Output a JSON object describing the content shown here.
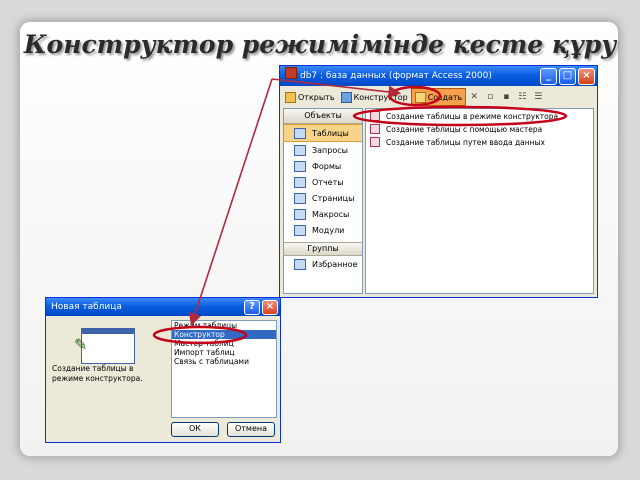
{
  "slide": {
    "title": "Конструктор режиміміндe кесте құру"
  },
  "db_window": {
    "title": "db7 : база данных (формат Access 2000)",
    "controls": {
      "minimize": "_",
      "maximize": "□",
      "close": "×"
    },
    "toolbar": {
      "open": "Открыть",
      "design": "Конструктор",
      "create": "Создать"
    },
    "panel_header": "Объекты",
    "objects": [
      {
        "label": "Таблицы",
        "icon": "table-icon"
      },
      {
        "label": "Запросы",
        "icon": "query-icon"
      },
      {
        "label": "Формы",
        "icon": "form-icon"
      },
      {
        "label": "Отчеты",
        "icon": "report-icon"
      },
      {
        "label": "Страницы",
        "icon": "page-icon"
      },
      {
        "label": "Макросы",
        "icon": "macro-icon"
      },
      {
        "label": "Модули",
        "icon": "module-icon"
      }
    ],
    "groups_header": "Группы",
    "groups": [
      {
        "label": "Избранное",
        "icon": "folder-icon"
      }
    ],
    "list_items": [
      "Создание таблицы в режиме конструктора",
      "Создание таблицы с помощью мастера",
      "Создание таблицы путем ввода данных"
    ]
  },
  "new_table_dialog": {
    "title": "Новая таблица",
    "controls": {
      "help": "?",
      "close": "×"
    },
    "description": "Создание таблицы в режиме конструктора.",
    "options": [
      "Режим таблицы",
      "Конструктор",
      "Мастер таблиц",
      "Импорт таблиц",
      "Связь с таблицами"
    ],
    "selected_index": 1,
    "ok_label": "ОК",
    "cancel_label": "Отмена"
  },
  "colors": {
    "highlight": "#c4001a",
    "arrow": "#b22a3a",
    "titlebar": "#0a5fe0"
  }
}
